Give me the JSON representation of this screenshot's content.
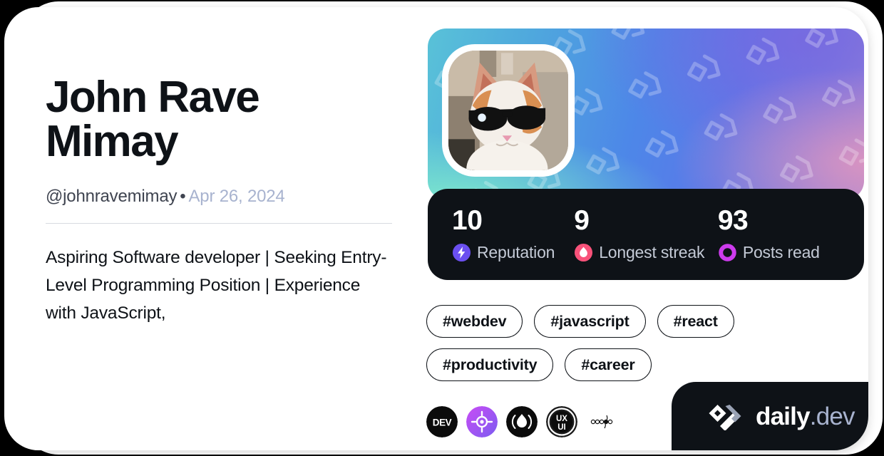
{
  "profile": {
    "display_name": "John Rave Mimay",
    "handle": "@johnravemimay",
    "separator": "•",
    "joined_date": "Apr 26, 2024",
    "bio": "Aspiring Software developer | Seeking Entry-Level Programming Position | Experience with JavaScript,",
    "avatar_alt": "cat-with-sunglasses-avatar"
  },
  "stats": [
    {
      "value": "10",
      "label": "Reputation",
      "icon": "reputation-bolt-icon",
      "color": "#6b4ff0"
    },
    {
      "value": "9",
      "label": "Longest streak",
      "icon": "streak-flame-icon",
      "color": "#f8527a"
    },
    {
      "value": "93",
      "label": "Posts read",
      "icon": "posts-read-ring-icon",
      "color": "#cd3bed"
    }
  ],
  "tags": [
    "#webdev",
    "#javascript",
    "#react",
    "#productivity",
    "#career"
  ],
  "sources": [
    "dev-to-source-icon",
    "purple-target-source-icon",
    "flame-source-icon",
    "ux-ui-source-icon",
    "dotted-molecule-source-icon"
  ],
  "brand": {
    "name": "daily",
    "tld": ".dev",
    "mark": "daily-dev-chevron-logo"
  },
  "theme": {
    "card_bg": "#ffffff",
    "page_bg": "#000000",
    "text_primary": "#0e1217",
    "text_muted": "#a8b3cf",
    "text_handle": "#3f4450",
    "stats_bg": "#0e1217",
    "divider": "#d8dbe0",
    "cover_gradient_start": "#59c2d8",
    "cover_gradient_mid": "#4d87e8",
    "cover_gradient_end": "#9f86d4"
  }
}
